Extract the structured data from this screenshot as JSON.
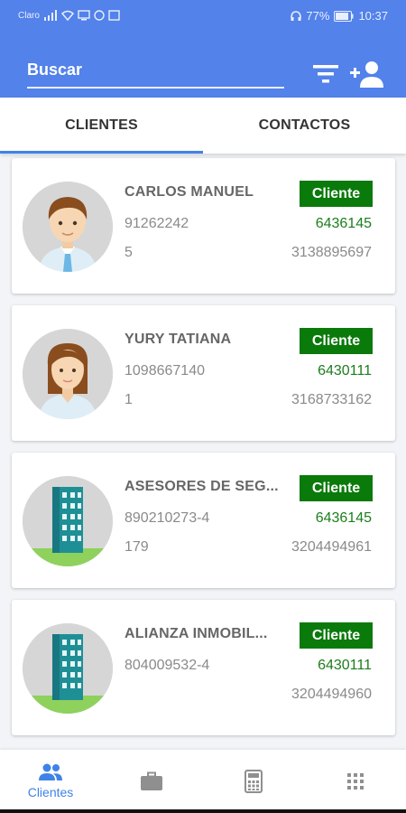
{
  "status_bar": {
    "carrier": "Claro",
    "battery": "77%",
    "time": "10:37"
  },
  "header": {
    "search_placeholder": "Buscar",
    "filter_icon": "filter-icon",
    "add_user_icon": "add-user-icon",
    "accent_color": "#5282ea"
  },
  "tabs": [
    {
      "label": "CLIENTES",
      "active": true
    },
    {
      "label": "CONTACTOS",
      "active": false
    }
  ],
  "clients": [
    {
      "name": "CARLOS MANUEL",
      "badge": "Cliente",
      "doc": "91262242",
      "code": "6436145",
      "extra": "5",
      "phone": "3138895697",
      "avatar": "male-avatar"
    },
    {
      "name": "YURY TATIANA",
      "badge": "Cliente",
      "doc": "1098667140",
      "code": "6430111",
      "extra": "1",
      "phone": "3168733162",
      "avatar": "female-avatar"
    },
    {
      "name": "ASESORES DE SEG...",
      "badge": "Cliente",
      "doc": "890210273-4",
      "code": "6436145",
      "extra": "179",
      "phone": "3204494961",
      "avatar": "building-avatar"
    },
    {
      "name": "ALIANZA INMOBIL...",
      "badge": "Cliente",
      "doc": "804009532-4",
      "code": "6430111",
      "extra": "",
      "phone": "3204494960",
      "avatar": "building-avatar"
    }
  ],
  "bottom_nav": [
    {
      "label": "Clientes",
      "icon": "people-icon",
      "active": true
    },
    {
      "label": "",
      "icon": "briefcase-icon",
      "active": false
    },
    {
      "label": "",
      "icon": "calculator-icon",
      "active": false
    },
    {
      "label": "",
      "icon": "apps-grid-icon",
      "active": false
    }
  ]
}
